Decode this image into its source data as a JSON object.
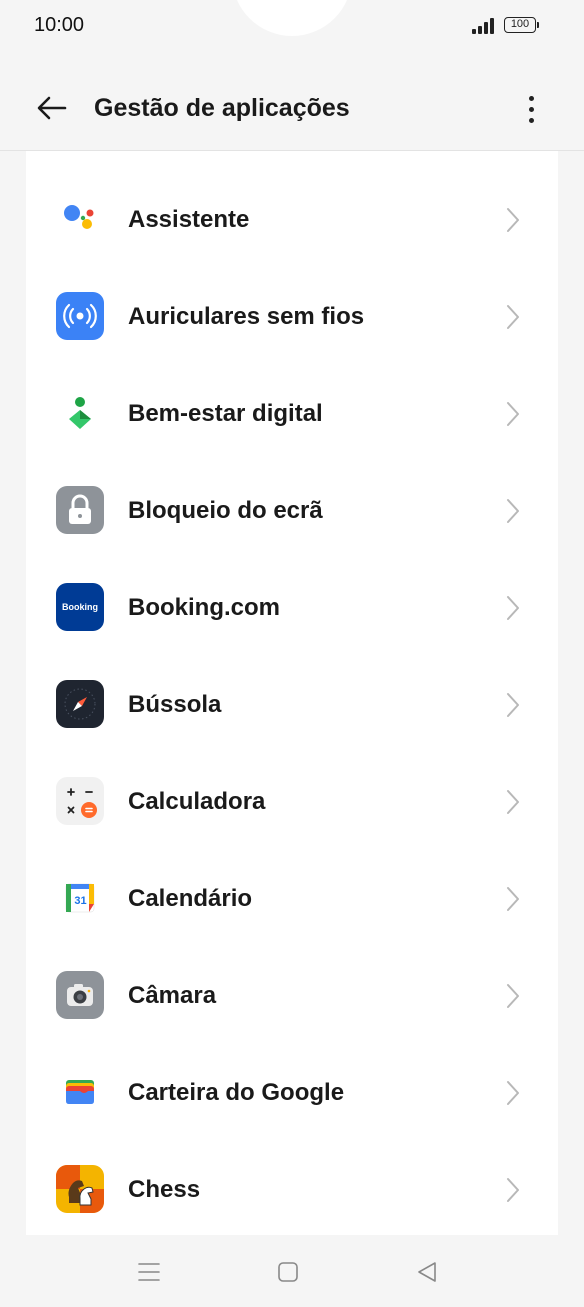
{
  "status_bar": {
    "time": "10:00",
    "battery": "100"
  },
  "header": {
    "title": "Gestão de aplicações",
    "back_icon": "arrow-left-icon",
    "menu_icon": "more-vertical-icon"
  },
  "apps": [
    {
      "label": "Assistente",
      "icon": "google-assistant-icon"
    },
    {
      "label": "Auriculares sem fios",
      "icon": "wireless-earphones-icon"
    },
    {
      "label": "Bem-estar digital",
      "icon": "digital-wellbeing-icon"
    },
    {
      "label": "Bloqueio do ecrã",
      "icon": "lock-screen-icon"
    },
    {
      "label": "Booking.com",
      "icon": "booking-icon",
      "icon_text": "Booking"
    },
    {
      "label": "Bússola",
      "icon": "compass-icon"
    },
    {
      "label": "Calculadora",
      "icon": "calculator-icon"
    },
    {
      "label": "Calendário",
      "icon": "calendar-icon",
      "icon_text": "31"
    },
    {
      "label": "Câmara",
      "icon": "camera-icon"
    },
    {
      "label": "Carteira do Google",
      "icon": "google-wallet-icon"
    },
    {
      "label": "Chess",
      "icon": "chess-icon"
    }
  ],
  "nav_bar": {
    "menu_icon": "recents-icon",
    "home_icon": "home-icon",
    "back_icon": "back-triangle-icon"
  },
  "colors": {
    "background": "#f5f5f5",
    "card": "#ffffff",
    "text": "#1a1a1a",
    "chevron": "#b8b8b8"
  }
}
